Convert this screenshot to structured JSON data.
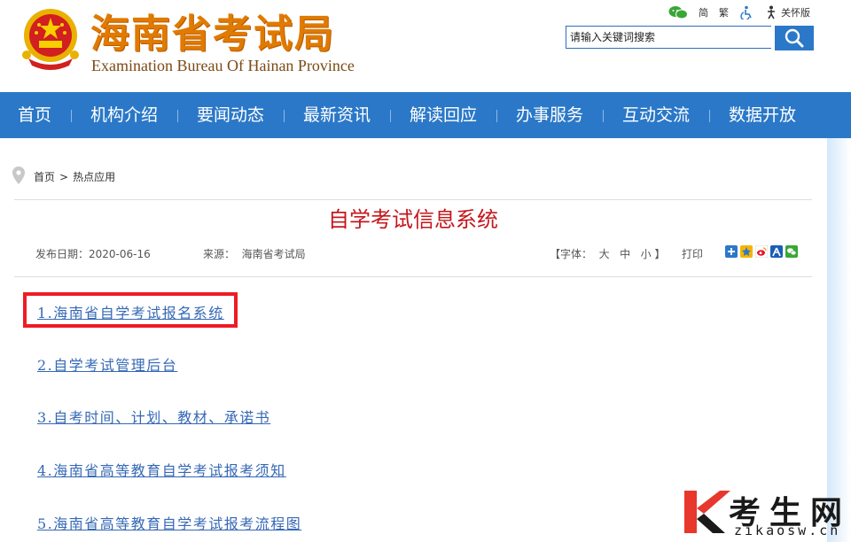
{
  "header": {
    "title": "海南省考试局",
    "subtitle": "Examination Bureau Of Hainan Province",
    "top_links": {
      "simplified": "简",
      "traditional": "繁",
      "care_mode": "关怀版"
    },
    "search": {
      "placeholder": "请输入关键词搜索"
    }
  },
  "nav": {
    "items": [
      {
        "label": "首页"
      },
      {
        "label": "机构介绍"
      },
      {
        "label": "要闻动态"
      },
      {
        "label": "最新资讯"
      },
      {
        "label": "解读回应"
      },
      {
        "label": "办事服务"
      },
      {
        "label": "互动交流"
      },
      {
        "label": "数据开放"
      }
    ]
  },
  "breadcrumb": {
    "home": "首页",
    "separator": ">",
    "current": "热点应用"
  },
  "article": {
    "title": "自学考试信息系统",
    "date_label": "发布日期：",
    "date": "2020-06-16",
    "source_label": "来源：",
    "source": "海南省考试局",
    "font_size": {
      "open": "【字体：",
      "large": "大",
      "medium": "中",
      "small": "小",
      "close": "】"
    },
    "print": "打印",
    "links": [
      {
        "text": "1.海南省自学考试报名系统"
      },
      {
        "text": "2.自学考试管理后台"
      },
      {
        "text": "3.自考时间、计划、教材、承诺书"
      },
      {
        "text": "4.海南省高等教育自学考试报考须知"
      },
      {
        "text": "5.海南省高等教育自学考试报考流程图"
      }
    ]
  },
  "watermark": {
    "name": "考生网",
    "domain": "zikaosw.cn"
  },
  "colors": {
    "nav_bg": "#2b78c8",
    "title_red": "#c4171c",
    "link_blue": "#3568b5",
    "highlight": "#ee1c25",
    "logo_orange": "#e07a00"
  },
  "icons": [
    "emblem-icon",
    "wechat-icon",
    "accessibility-icon",
    "care-mode-icon",
    "search-icon",
    "location-pin-icon",
    "share-add-icon",
    "share-qzone-icon",
    "share-weibo-icon",
    "share-renren-icon",
    "share-wechat-icon",
    "watermark-logo-icon"
  ]
}
